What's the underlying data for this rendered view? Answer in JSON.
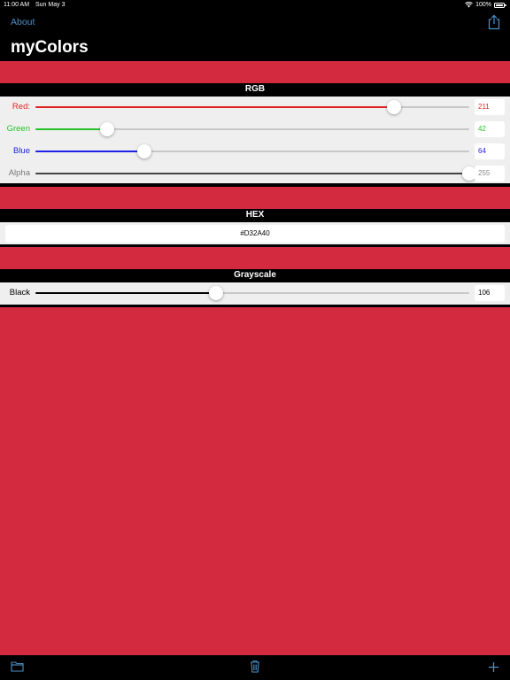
{
  "status_bar": {
    "time": "11:00 AM",
    "date": "Sun May 3",
    "battery": "100%"
  },
  "nav": {
    "about_label": "About",
    "share_icon": "share-icon",
    "title": "myColors"
  },
  "colors": {
    "swatch": "#D32A40",
    "red": "#e02424",
    "green": "#27c12a",
    "blue": "#1f22e6",
    "alpha": "#7a7a7a",
    "black": "#000000",
    "link": "#4a90c8"
  },
  "rgb": {
    "header": "RGB",
    "red": {
      "label": "Red:",
      "value": "211",
      "fraction": 0.827
    },
    "green": {
      "label": "Green",
      "value": "42",
      "fraction": 0.165
    },
    "blue": {
      "label": "Blue",
      "value": "64",
      "fraction": 0.251
    },
    "alpha": {
      "label": "Alpha",
      "value": "255",
      "fraction": 1.0
    }
  },
  "hex": {
    "header": "HEX",
    "value": "#D32A40"
  },
  "grayscale": {
    "header": "Grayscale",
    "black": {
      "label": "Black",
      "value": "106",
      "fraction": 0.416
    }
  },
  "tab_bar": {
    "left_icon": "folder-icon",
    "center_icon": "trash-icon",
    "right_icon": "plus-icon"
  }
}
